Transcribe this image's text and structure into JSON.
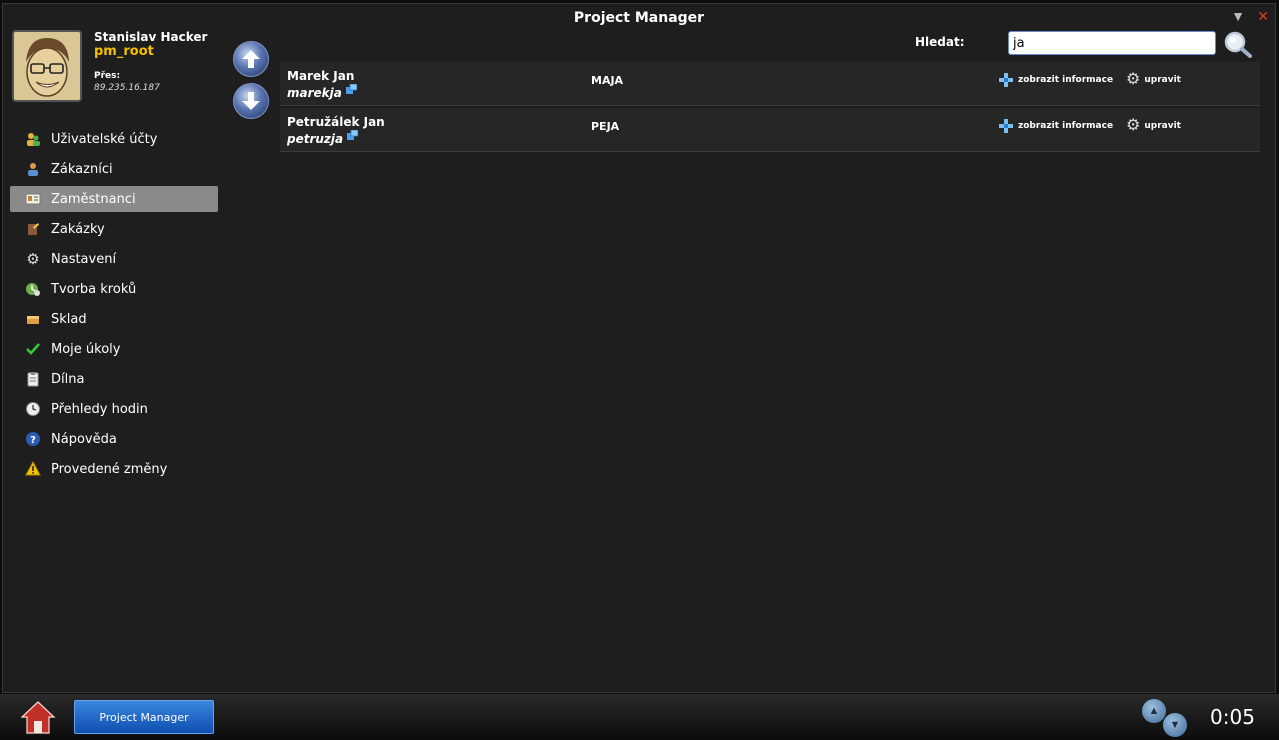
{
  "window": {
    "title": "Project Manager"
  },
  "user": {
    "name": "Stanislav Hacker",
    "role": "pm_root",
    "via_label": "Přes:",
    "ip": "89.235.16.187"
  },
  "menu": [
    {
      "label": "Uživatelské účty",
      "icon": "users-icon"
    },
    {
      "label": "Zákazníci",
      "icon": "customers-icon"
    },
    {
      "label": "Zaměstnanci",
      "icon": "id-card-icon",
      "active": true
    },
    {
      "label": "Zakázky",
      "icon": "orders-icon"
    },
    {
      "label": "Nastavení",
      "icon": "gear-icon"
    },
    {
      "label": "Tvorba kroků",
      "icon": "steps-icon"
    },
    {
      "label": "Sklad",
      "icon": "warehouse-icon"
    },
    {
      "label": "Moje úkoly",
      "icon": "checkmark-icon"
    },
    {
      "label": "Dílna",
      "icon": "clipboard-icon"
    },
    {
      "label": "Přehledy hodin",
      "icon": "clock-icon"
    },
    {
      "label": "Nápověda",
      "icon": "help-icon"
    },
    {
      "label": "Provedené změny",
      "icon": "warning-icon"
    }
  ],
  "search": {
    "label": "Hledat:",
    "value": "ja"
  },
  "employees": [
    {
      "name": "Marek Jan",
      "login": "marekja",
      "code": "MAJA"
    },
    {
      "name": "Petružálek Jan",
      "login": "petruzja",
      "code": "PEJA"
    }
  ],
  "actions": {
    "info_label": "zobrazit informace",
    "edit_label": "upravit"
  },
  "taskbar": {
    "app_label": "Project Manager",
    "clock": "0:05"
  },
  "colors": {
    "accent_yellow": "#f2c000",
    "active_menu": "#8a8a8a",
    "close_red": "#e03a2a",
    "taskbar_blue": "#1e6fd0"
  }
}
